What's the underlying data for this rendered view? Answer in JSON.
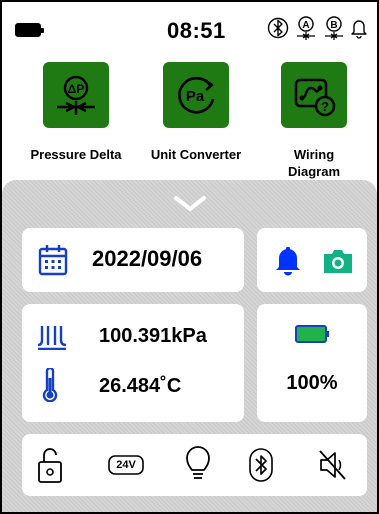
{
  "status_bar": {
    "time": "08:51",
    "icons": [
      "battery-icon",
      "bluetooth-icon",
      "channel-a-icon",
      "channel-b-icon",
      "bell-icon"
    ],
    "channel_a_letter": "A",
    "channel_b_letter": "B"
  },
  "apps": [
    {
      "label": "Pressure Delta",
      "icon": "pressure-delta-icon",
      "icon_text": "ΔP"
    },
    {
      "label": "Unit Converter",
      "icon": "unit-converter-icon",
      "icon_text": "Pa"
    },
    {
      "label": "Wiring Diagram",
      "icon": "wiring-diagram-icon",
      "icon_text": "?"
    }
  ],
  "panel": {
    "date": "2022/09/06",
    "pressure": "100.391kPa",
    "temperature": "26.484˚C",
    "battery_percent": "100%",
    "toggles": {
      "power_label": "24V"
    }
  },
  "colors": {
    "accent_green": "#1f7a14",
    "bell_blue": "#0033ff",
    "camera_teal": "#11b386",
    "calendar_blue": "#1540c6",
    "battery_fill": "#22b24c",
    "thermometer_blue": "#1540c6",
    "panel_bg": "#d6d6d6"
  }
}
